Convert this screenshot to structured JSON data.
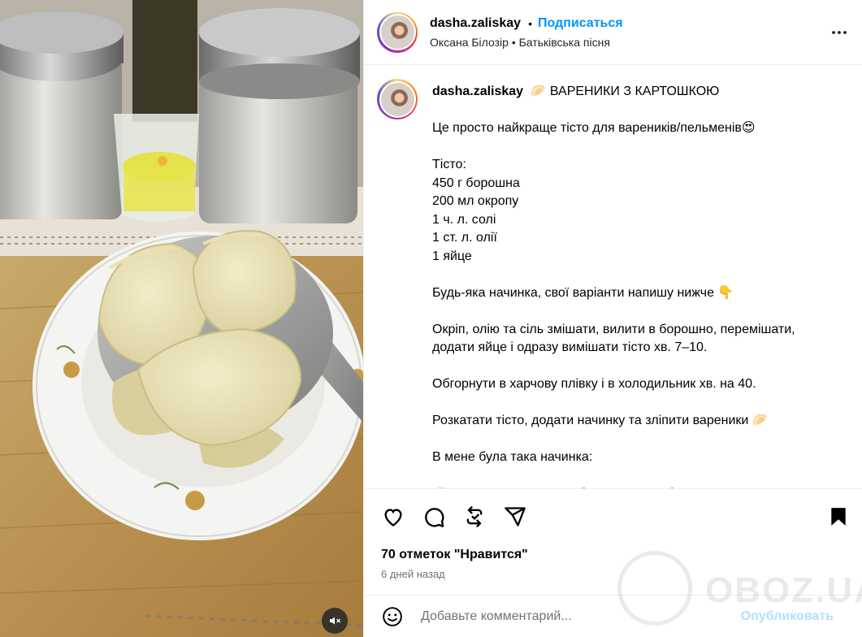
{
  "post": {
    "username": "dasha.zaliskay",
    "separator": "•",
    "follow_label": "Подписаться",
    "audio": "Оксана Білозір • Батьківська пісня",
    "more_icon": "more-horizontal-icon"
  },
  "caption": {
    "username": "dasha.zaliskay",
    "title": "🥟 ВАРЕНИКИ З КАРТОШКОЮ",
    "lines": [
      "Це просто найкраще тісто для вареників/пельменів😍",
      "",
      "Тісто:",
      "450 г борошна",
      "200 мл окропу",
      "1 ч. л. солі",
      "1 ст. л. олії",
      "1 яйце",
      "",
      "Будь-яка начинка, свої варіанти напишу нижче 👇",
      "",
      "Окріп, олію та сіль змішати, вилити в борошно, перемішати,",
      "додати яйце і одразу вимішати тісто хв. 7–10.",
      "",
      "Обгорнути в харчову плівку і в холодильник хв. на 40.",
      "",
      "Розкатати тісто, додати начинку та зліпити вареники 🥟",
      "",
      "В мене була така начинка:",
      "",
      "🥟 Картопляне пюре з обсмаженою цибулею"
    ]
  },
  "actions": {
    "icons": [
      "heart-icon",
      "comment-icon",
      "repost-icon",
      "share-icon",
      "bookmark-icon"
    ]
  },
  "likes_text": "70 отметок \"Нравится\"",
  "time_ago": "6 дней назад",
  "comment": {
    "placeholder": "Добавьте комментарий...",
    "publish_label": "Опубликовать"
  },
  "watermark": "OBOZ.UA",
  "colors": {
    "link_blue": "#0095f6",
    "publish_disabled": "#b2dffc",
    "secondary_text": "#737373"
  }
}
